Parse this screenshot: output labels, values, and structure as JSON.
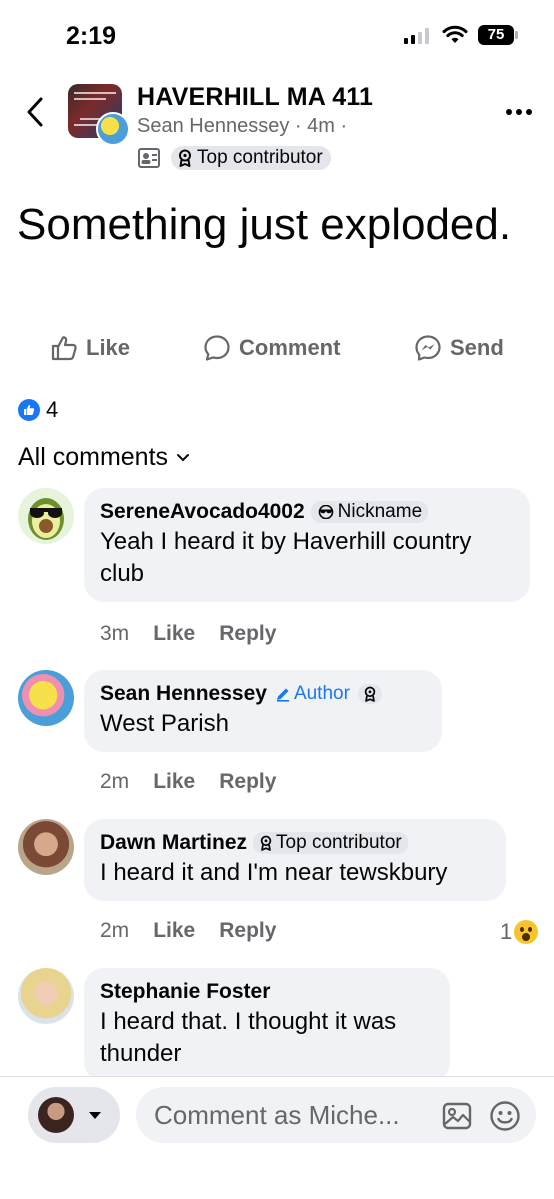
{
  "status_bar": {
    "time": "2:19",
    "battery": "75"
  },
  "header": {
    "group_name": "HAVERHILL MA 411",
    "author": "Sean Hennessey",
    "time": "4m",
    "separator": "·",
    "badge": "Top contributor"
  },
  "post": {
    "text": "Something just exploded.",
    "actions": {
      "like": "Like",
      "comment": "Comment",
      "send": "Send"
    },
    "reaction_count": "4"
  },
  "comments_sort": "All comments",
  "comments": [
    {
      "name": "SereneAvocado4002",
      "badge": "Nickname",
      "text": "Yeah I heard it by Haverhill country club",
      "time": "3m",
      "like": "Like",
      "reply": "Reply"
    },
    {
      "name": "Sean Hennessey",
      "badge": "Author",
      "text": "West Parish",
      "time": "2m",
      "like": "Like",
      "reply": "Reply"
    },
    {
      "name": "Dawn Martinez",
      "badge": "Top contributor",
      "text": "I heard it and I'm near tewskbury",
      "time": "2m",
      "like": "Like",
      "reply": "Reply",
      "reactions": "1"
    },
    {
      "name": "Stephanie Foster",
      "text": "I heard that. I thought it was thunder"
    }
  ],
  "composer": {
    "placeholder": "Comment as Miche..."
  },
  "colors": {
    "accent": "#1877f2",
    "secondary_text": "#65676b",
    "bubble": "#f0f2f5"
  }
}
